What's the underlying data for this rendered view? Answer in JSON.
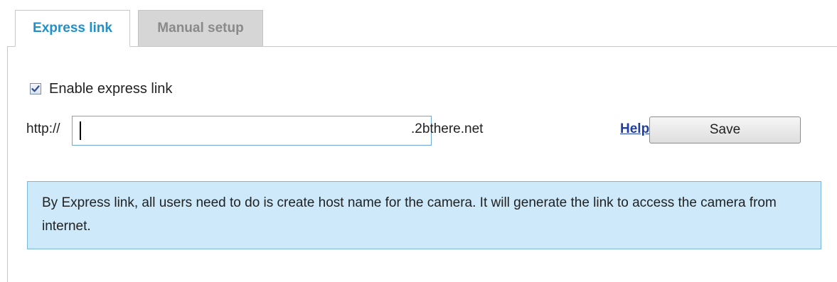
{
  "tabs": [
    {
      "label": "Express link",
      "active": true
    },
    {
      "label": "Manual setup",
      "active": false
    }
  ],
  "express": {
    "enable_label": "Enable express link",
    "enabled": true,
    "url_prefix": "http://",
    "host_value": "",
    "url_suffix": ".2bthere.net",
    "help_label": "Help",
    "save_label": "Save"
  },
  "info": {
    "text": "By Express link, all users need to do is create host name for the camera. It will generate the link to access the camera from internet."
  },
  "colors": {
    "active_tab_text": "#1f90cf",
    "inactive_tab_bg": "#d6d6d6",
    "info_bg": "#cde9fa",
    "info_border": "#7ab8dc",
    "link": "#1f3fa6"
  },
  "icons": {
    "checkbox": "checkmark-icon"
  }
}
